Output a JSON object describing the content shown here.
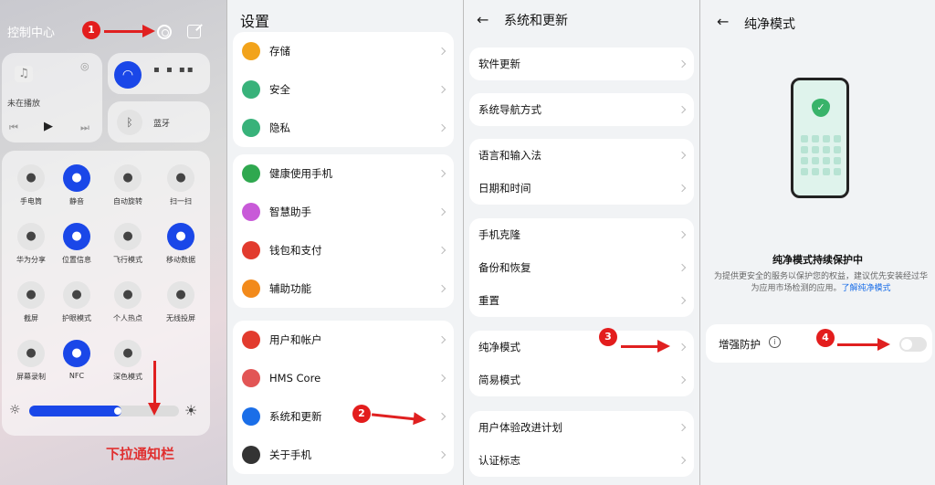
{
  "control_center": {
    "title": "控制中心",
    "now_playing": "未在播放",
    "bluetooth_label": "蓝牙",
    "tiles": [
      {
        "label": "手电筒",
        "icon": "flashlight-icon",
        "on": false
      },
      {
        "label": "静音",
        "icon": "mute-bell-icon",
        "on": true
      },
      {
        "label": "自动旋转",
        "icon": "rotate-icon",
        "on": false
      },
      {
        "label": "扫一扫",
        "icon": "scan-icon",
        "on": false
      },
      {
        "label": "华为分享",
        "icon": "share-icon",
        "on": false
      },
      {
        "label": "位置信息",
        "icon": "location-icon",
        "on": true
      },
      {
        "label": "飞行模式",
        "icon": "airplane-icon",
        "on": false
      },
      {
        "label": "移动数据",
        "icon": "mobile-data-icon",
        "on": true
      },
      {
        "label": "截屏",
        "icon": "screenshot-icon",
        "on": false
      },
      {
        "label": "护眼模式",
        "icon": "eye-icon",
        "on": false
      },
      {
        "label": "个人热点",
        "icon": "hotspot-icon",
        "on": false
      },
      {
        "label": "无线投屏",
        "icon": "cast-icon",
        "on": false
      },
      {
        "label": "屏幕录制",
        "icon": "record-icon",
        "on": false
      },
      {
        "label": "NFC",
        "icon": "nfc-icon",
        "on": true
      },
      {
        "label": "深色模式",
        "icon": "dark-mode-icon",
        "on": false
      }
    ],
    "brightness": 0.58,
    "pull_caption": "下拉通知栏"
  },
  "settings": {
    "title": "设置",
    "groups": [
      [
        {
          "label": "存储",
          "color": "#f2a31b",
          "icon": "storage-icon"
        },
        {
          "label": "安全",
          "color": "#38b27a",
          "icon": "security-icon"
        },
        {
          "label": "隐私",
          "color": "#38b27a",
          "icon": "privacy-icon"
        }
      ],
      [
        {
          "label": "健康使用手机",
          "color": "#2fa84f",
          "icon": "health-icon"
        },
        {
          "label": "智慧助手",
          "color": "#c85ad8",
          "icon": "assistant-icon"
        },
        {
          "label": "钱包和支付",
          "color": "#e23b2e",
          "icon": "wallet-icon"
        },
        {
          "label": "辅助功能",
          "color": "#f28a1b",
          "icon": "accessibility-icon"
        }
      ],
      [
        {
          "label": "用户和帐户",
          "color": "#e23b2e",
          "icon": "user-icon"
        },
        {
          "label": "HMS Core",
          "color": "#e25555",
          "icon": "hms-icon"
        },
        {
          "label": "系统和更新",
          "color": "#1a6ee8",
          "icon": "system-icon"
        },
        {
          "label": "关于手机",
          "color": "#333333",
          "icon": "about-icon"
        }
      ]
    ]
  },
  "system": {
    "title": "系统和更新",
    "groups": [
      [
        "软件更新"
      ],
      [
        "系统导航方式"
      ],
      [
        "语言和输入法",
        "日期和时间"
      ],
      [
        "手机克隆",
        "备份和恢复",
        "重置"
      ],
      [
        "纯净模式",
        "简易模式"
      ],
      [
        "用户体验改进计划",
        "认证标志"
      ]
    ]
  },
  "pure_mode": {
    "title": "纯净模式",
    "heading": "纯净模式持续保护中",
    "description": "为提供更安全的服务以保护您的权益，建议优先安装经过华为应用市场检测的应用。",
    "link": "了解纯净模式",
    "enhanced_label": "增强防护",
    "enhanced_on": false
  },
  "annotations": [
    "1",
    "2",
    "3",
    "4"
  ],
  "colors": {
    "accent": "#1a47e8",
    "marker": "#e31d1d"
  }
}
